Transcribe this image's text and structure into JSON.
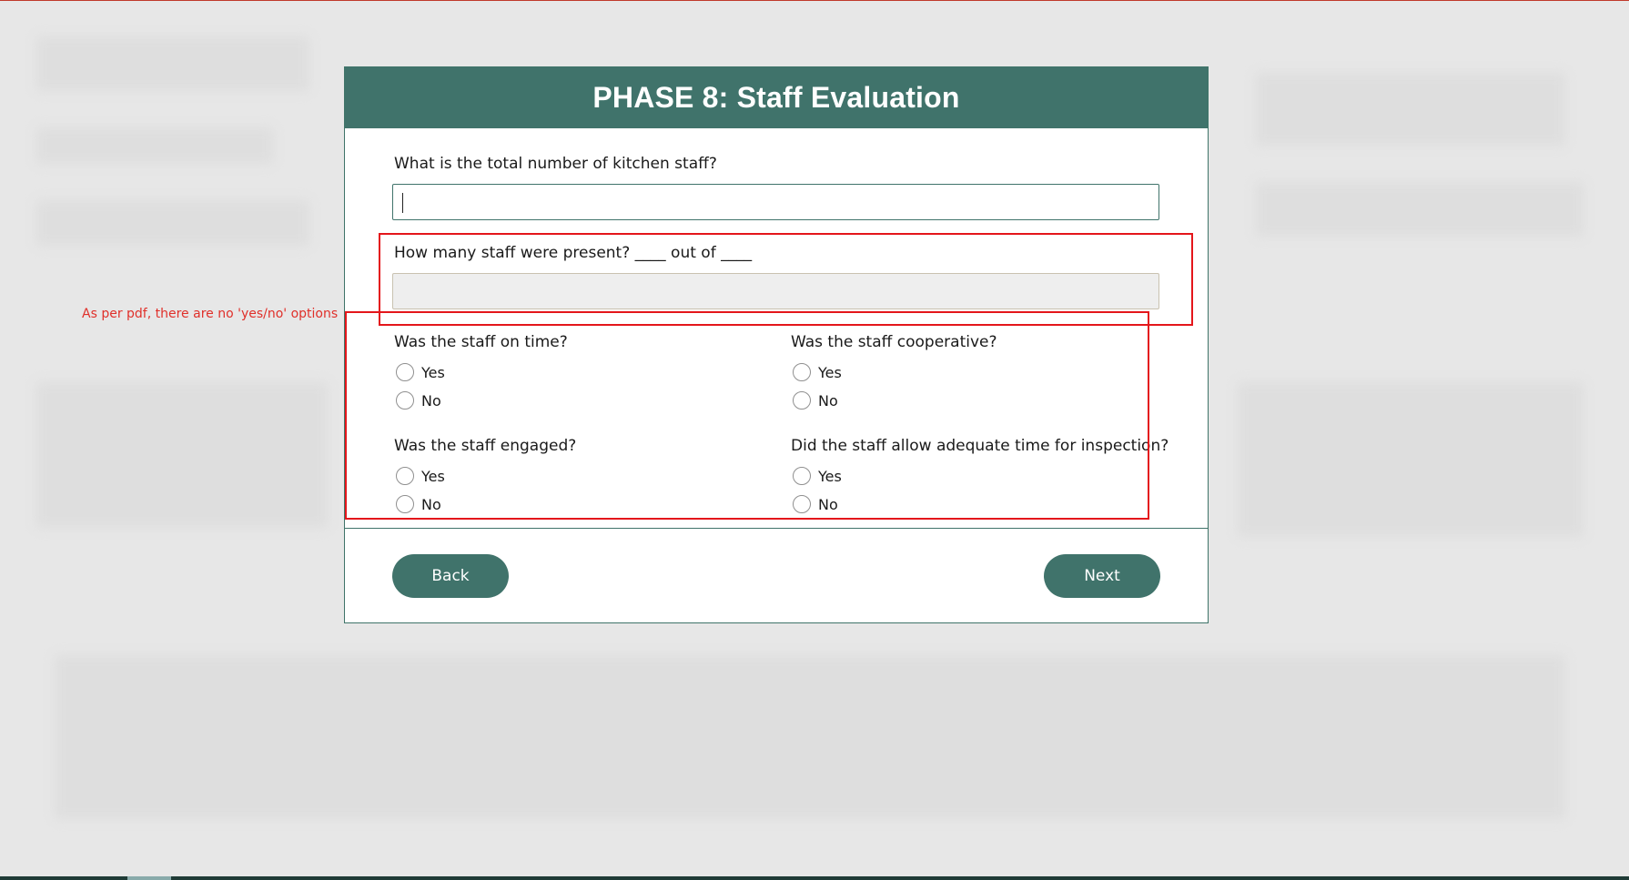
{
  "annotation": {
    "note": "As per pdf, there are no 'yes/no' options"
  },
  "modal": {
    "title": "PHASE 8: Staff Evaluation",
    "q_total_staff": {
      "label": "What is the total number of kitchen staff?",
      "value": ""
    },
    "q_present": {
      "label": "How many staff were present? ____ out of ____",
      "value": ""
    },
    "radio_questions": [
      {
        "label": "Was the staff on time?",
        "options": [
          "Yes",
          "No"
        ]
      },
      {
        "label": "Was the staff cooperative?",
        "options": [
          "Yes",
          "No"
        ]
      },
      {
        "label": "Was the staff engaged?",
        "options": [
          "Yes",
          "No"
        ]
      },
      {
        "label": "Did the staff allow adequate time for inspection?",
        "options": [
          "Yes",
          "No"
        ]
      }
    ],
    "back_label": "Back",
    "next_label": "Next"
  },
  "colors": {
    "header": "#40736b",
    "button": "#40736b",
    "annotation_red": "#e4161b"
  }
}
